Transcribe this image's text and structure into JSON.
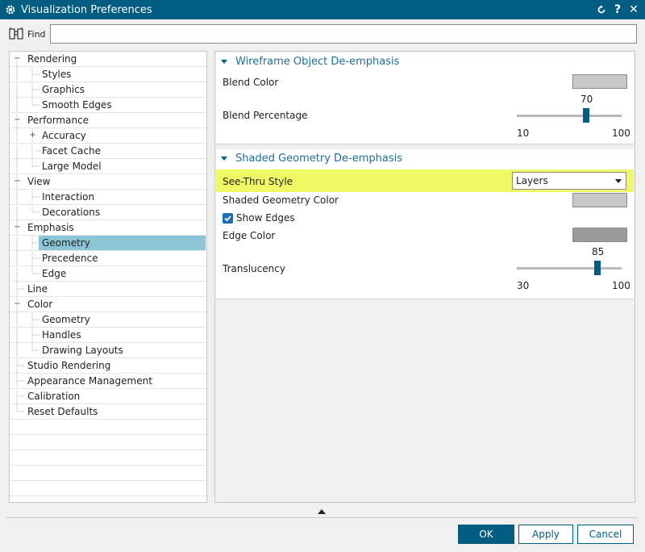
{
  "window": {
    "title": "Visualization Preferences"
  },
  "find": {
    "label": "Find",
    "value": ""
  },
  "tree": {
    "items": [
      {
        "label": "Rendering",
        "level": 0,
        "expander": "−"
      },
      {
        "label": "Styles",
        "level": 1
      },
      {
        "label": "Graphics",
        "level": 1
      },
      {
        "label": "Smooth Edges",
        "level": 1
      },
      {
        "label": "Performance",
        "level": 0,
        "expander": "−"
      },
      {
        "label": "Accuracy",
        "level": 1,
        "expander": "+"
      },
      {
        "label": "Facet Cache",
        "level": 1
      },
      {
        "label": "Large Model",
        "level": 1
      },
      {
        "label": "View",
        "level": 0,
        "expander": "−"
      },
      {
        "label": "Interaction",
        "level": 1
      },
      {
        "label": "Decorations",
        "level": 1
      },
      {
        "label": "Emphasis",
        "level": 0,
        "expander": "−"
      },
      {
        "label": "Geometry",
        "level": 1,
        "selected": true
      },
      {
        "label": "Precedence",
        "level": 1
      },
      {
        "label": "Edge",
        "level": 1
      },
      {
        "label": "Line",
        "level": 0
      },
      {
        "label": "Color",
        "level": 0,
        "expander": "−"
      },
      {
        "label": "Geometry",
        "level": 1
      },
      {
        "label": "Handles",
        "level": 1
      },
      {
        "label": "Drawing Layouts",
        "level": 1
      },
      {
        "label": "Studio Rendering",
        "level": 0
      },
      {
        "label": "Appearance Management",
        "level": 0
      },
      {
        "label": "Calibration",
        "level": 0
      },
      {
        "label": "Reset Defaults",
        "level": 0
      }
    ]
  },
  "wireframe": {
    "title": "Wireframe Object De-emphasis",
    "blend_color_label": "Blend Color",
    "blend_color": "#c8c8c8",
    "blend_percentage_label": "Blend Percentage",
    "blend_value": "70",
    "blend_min": "10",
    "blend_max": "100"
  },
  "shaded": {
    "title": "Shaded Geometry De-emphasis",
    "see_thru_label": "See-Thru Style",
    "see_thru_value": "Layers",
    "geometry_color_label": "Shaded Geometry Color",
    "geometry_color": "#c8c8c8",
    "show_edges_label": "Show Edges",
    "show_edges_checked": true,
    "edge_color_label": "Edge Color",
    "edge_color": "#9a9a9a",
    "translucency_label": "Translucency",
    "translucency_value": "85",
    "translucency_min": "30",
    "translucency_max": "100"
  },
  "buttons": {
    "ok": "OK",
    "apply": "Apply",
    "cancel": "Cancel"
  },
  "colors": {
    "accent": "#005c80",
    "highlight": "#eef963",
    "selection": "#8cc6d6"
  }
}
